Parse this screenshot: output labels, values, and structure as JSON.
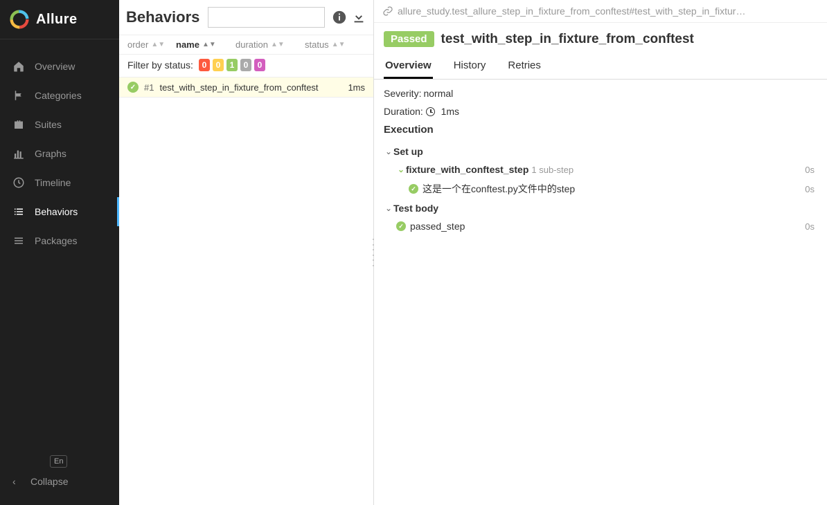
{
  "brand": {
    "name": "Allure"
  },
  "sidebar": {
    "items": [
      {
        "label": "Overview",
        "icon": "home"
      },
      {
        "label": "Categories",
        "icon": "flag"
      },
      {
        "label": "Suites",
        "icon": "briefcase"
      },
      {
        "label": "Graphs",
        "icon": "bar-chart"
      },
      {
        "label": "Timeline",
        "icon": "clock"
      },
      {
        "label": "Behaviors",
        "icon": "list"
      },
      {
        "label": "Packages",
        "icon": "layers"
      }
    ],
    "lang": "En",
    "collapse": "Collapse"
  },
  "mid": {
    "title": "Behaviors",
    "search_placeholder": "",
    "sort": {
      "order": "order",
      "name": "name",
      "duration": "duration",
      "status": "status"
    },
    "filter_label": "Filter by status:",
    "filter_counts": [
      {
        "key": "failed",
        "value": "0",
        "color": "red"
      },
      {
        "key": "broken",
        "value": "0",
        "color": "yellow"
      },
      {
        "key": "passed",
        "value": "1",
        "color": "green"
      },
      {
        "key": "skipped",
        "value": "0",
        "color": "grey"
      },
      {
        "key": "unknown",
        "value": "0",
        "color": "purple"
      }
    ],
    "tests": [
      {
        "status": "passed",
        "num": "#1",
        "name": "test_with_step_in_fixture_from_conftest",
        "duration": "1ms"
      }
    ]
  },
  "right": {
    "breadcrumb": "allure_study.test_allure_step_in_fixture_from_conftest#test_with_step_in_fixtur…",
    "status_badge": "Passed",
    "title": "test_with_step_in_fixture_from_conftest",
    "tabs": [
      {
        "label": "Overview",
        "active": true
      },
      {
        "label": "History",
        "active": false
      },
      {
        "label": "Retries",
        "active": false
      }
    ],
    "severity_label": "Severity:",
    "severity_value": "normal",
    "duration_label": "Duration:",
    "duration_value": "1ms",
    "execution_label": "Execution",
    "setup_label": "Set up",
    "setup_steps": [
      {
        "name": "fixture_with_conftest_step",
        "sub": "1 sub-step",
        "dur": "0s",
        "children": [
          {
            "name": "这是一个在conftest.py文件中的step",
            "dur": "0s"
          }
        ]
      }
    ],
    "body_label": "Test body",
    "body_steps": [
      {
        "name": "passed_step",
        "dur": "0s"
      }
    ]
  }
}
